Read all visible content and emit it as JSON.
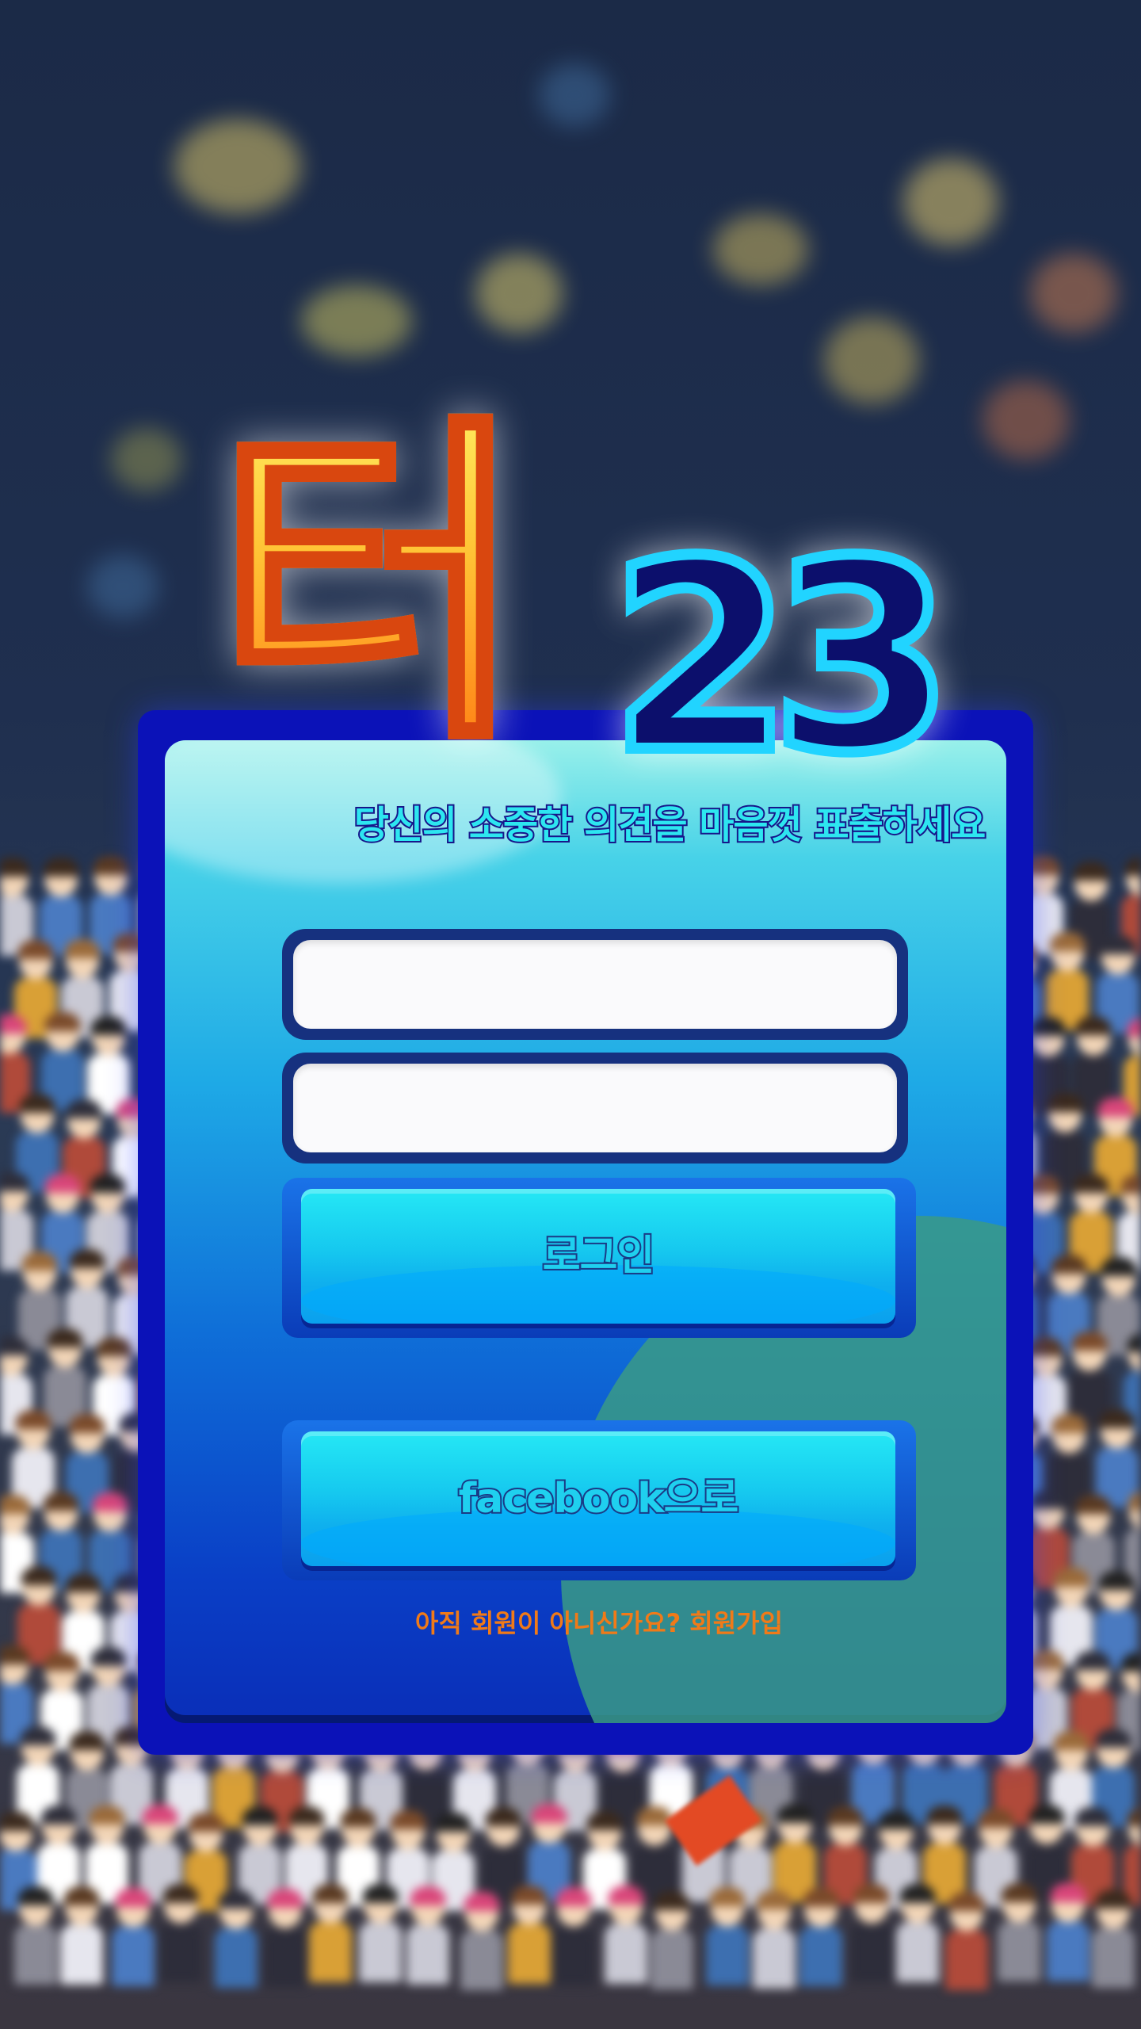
{
  "logo": {
    "title_char": "터",
    "number": "23"
  },
  "tagline": "당신의 소중한 의견을 마음껏 표출하세요",
  "form": {
    "username_value": "",
    "password_value": ""
  },
  "buttons": {
    "login_label": "로그인",
    "facebook_label": "facebook으로"
  },
  "signup_link": "아직 회원이 아니신가요? 회원가입",
  "colors": {
    "panel_border": "#0b12b8",
    "logo_orange": "#ffb232",
    "logo_cyan": "#21d4ff",
    "signup_orange": "#f07a18",
    "button_cyan": "#16c9ef"
  }
}
